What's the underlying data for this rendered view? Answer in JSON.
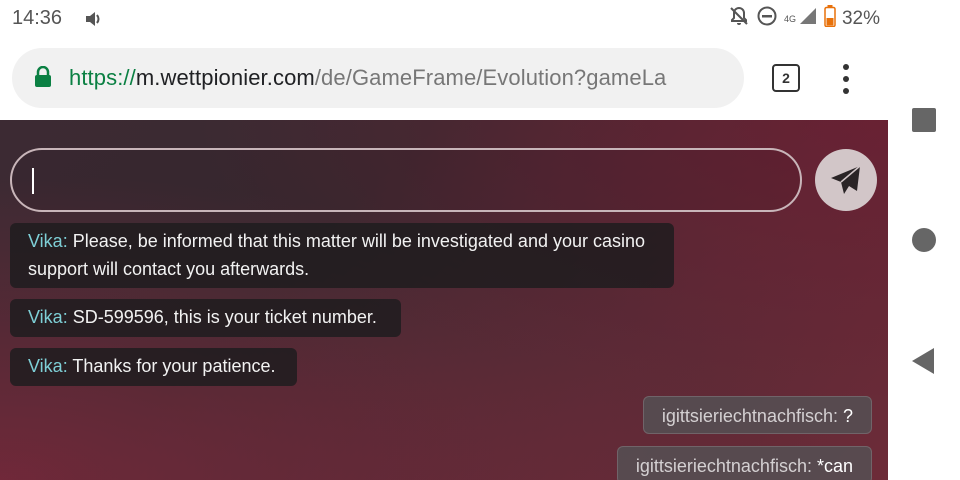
{
  "status_bar": {
    "time": "14:36",
    "network": "4G",
    "battery": "32%",
    "icons": [
      "volume-icon",
      "mute-icon",
      "do-not-disturb-icon",
      "signal-icon",
      "battery-icon"
    ]
  },
  "browser": {
    "url_scheme": "https://",
    "url_host": "m.wettpionier.com",
    "url_path": "/de/GameFrame/Evolution?gameLa",
    "tab_count": "2",
    "colors": {
      "secure": "#0b8043"
    }
  },
  "chat": {
    "input_value": "",
    "messages": [
      {
        "author": "Vika:",
        "text": " Please, be informed that this matter will be investigated and your casino support will contact you afterwards."
      },
      {
        "author": "Vika:",
        "text": " SD-599596, this is your ticket number."
      },
      {
        "author": "Vika:",
        "text": " Thanks for your patience."
      }
    ],
    "own_messages": [
      {
        "author": "igittsieriechtnachfisch:",
        "text": " ?"
      },
      {
        "author": "igittsieriechtnachfisch:",
        "text": " *can"
      }
    ],
    "colors": {
      "author": "#7ecfd6"
    }
  },
  "nav_bar": {
    "icons": [
      "recents-icon",
      "home-icon",
      "back-icon"
    ]
  }
}
